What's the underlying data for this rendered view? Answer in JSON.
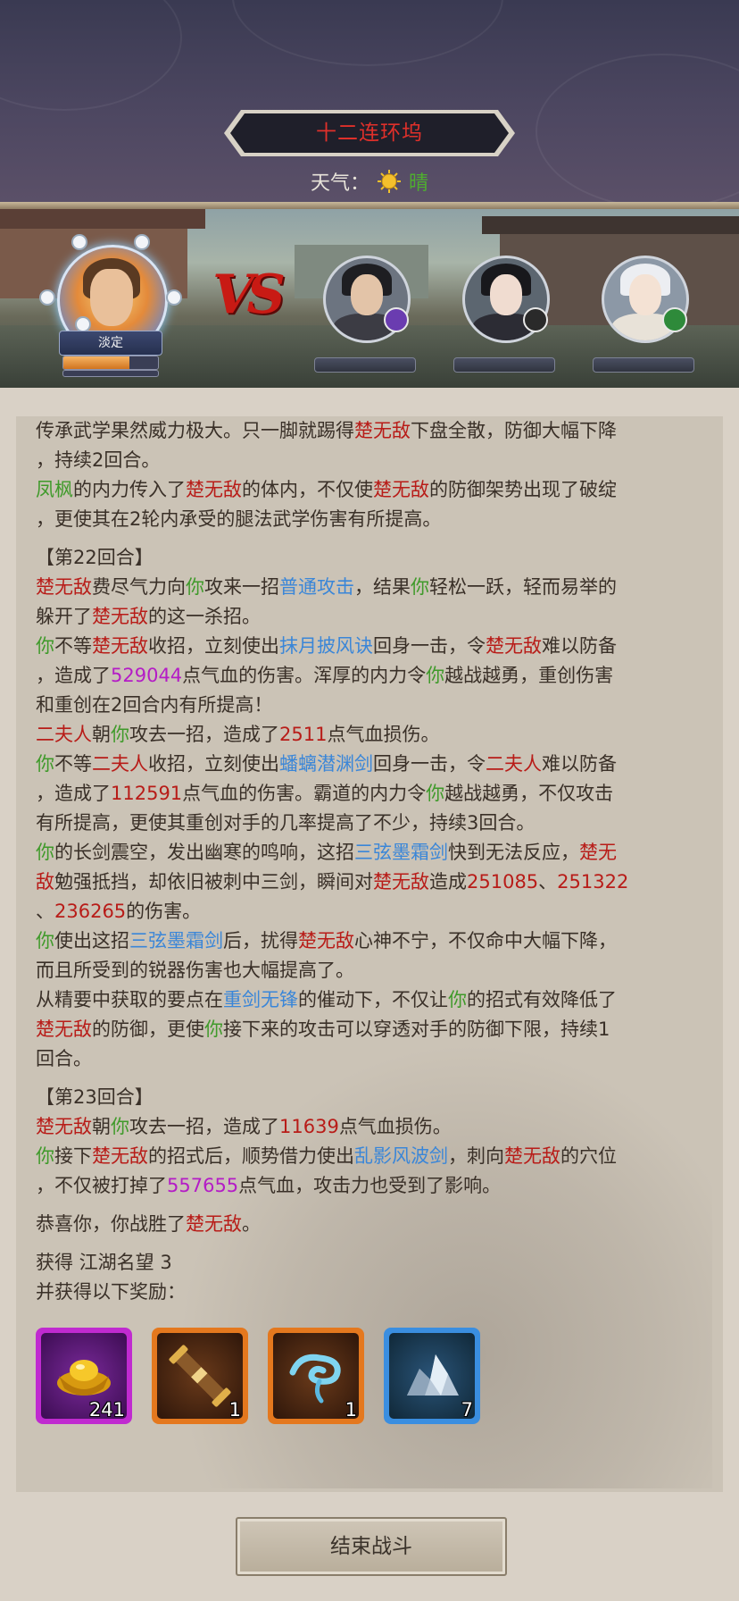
{
  "header": {
    "location_title": "十二连环坞",
    "weather_label": "天气：",
    "weather_icon": "sun-icon",
    "weather_value": "晴"
  },
  "battle": {
    "player_status": "淡定",
    "player_hp_fraction": 0.7,
    "vs_text": "VS",
    "enemies": [
      {
        "icon": "enemy-1-avatar",
        "badge_color": "#6a3cb0"
      },
      {
        "icon": "enemy-2-avatar",
        "badge_color": "#2a2a2a"
      },
      {
        "icon": "enemy-3-avatar",
        "badge_color": "#2e8a3a"
      }
    ]
  },
  "colors": {
    "enemy_name": "#b81c18",
    "ally_name": "#3f9a2a",
    "skill": "#3a86d8",
    "damage": "#b41cc6"
  },
  "log": {
    "l1": {
      "a": "传承武学果然威力极大。只一脚就踢得",
      "b": "楚无敌",
      "c": "下盘全散，防御大幅下降"
    },
    "l2": "，持续2回合。",
    "l3": {
      "a": "凤枫",
      "b": "的内力传入了",
      "c": "楚无敌",
      "d": "的体内，不仅使",
      "e": "楚无敌",
      "f": "的防御架势出现了破绽"
    },
    "l4": "，更使其在2轮内承受的腿法武学伤害有所提高。",
    "round22": "【第22回合】",
    "l5": {
      "a": "楚无敌",
      "b": "费尽气力向",
      "c": "你",
      "d": "攻来一招",
      "e": "普通攻击",
      "f": "，结果",
      "g": "你",
      "h": "轻松一跃，轻而易举的"
    },
    "l6": {
      "a": "躲开了",
      "b": "楚无敌",
      "c": "的这一杀招。"
    },
    "l7": {
      "a": "你",
      "b": "不等",
      "c": "楚无敌",
      "d": "收招，立刻使出",
      "e": "抹月披风诀",
      "f": "回身一击，令",
      "g": "楚无敌",
      "h": "难以防备"
    },
    "l8": {
      "a": "，造成了",
      "b": "529044",
      "c": "点气血的伤害。浑厚的内力令",
      "d": "你",
      "e": "越战越勇，重创伤害"
    },
    "l9": "和重创在2回合内有所提高！",
    "l10": {
      "a": "二夫人",
      "b": "朝",
      "c": "你",
      "d": "攻去一招，造成了",
      "e": "2511",
      "f": "点气血损伤。"
    },
    "l11": {
      "a": "你",
      "b": "不等",
      "c": "二夫人",
      "d": "收招，立刻使出",
      "e": "蟠螭潜渊剑",
      "f": "回身一击，令",
      "g": "二夫人",
      "h": "难以防备"
    },
    "l12": {
      "a": "，造成了",
      "b": "112591",
      "c": "点气血的伤害。霸道的内力令",
      "d": "你",
      "e": "越战越勇，不仅攻击"
    },
    "l13": "有所提高，更使其重创对手的几率提高了不少，持续3回合。",
    "l14": {
      "a": "你",
      "b": "的长剑震空，发出幽寒的鸣响，这招",
      "c": "三弦墨霜剑",
      "d": "快到无法反应，",
      "e": "楚无"
    },
    "l15": {
      "a": "敌",
      "b": "勉强抵挡，却依旧被刺中三剑，瞬间对",
      "c": "楚无敌",
      "d": "造成",
      "e": "251085",
      "f": "、",
      "g": "251322"
    },
    "l16": {
      "a": "、",
      "b": "236265",
      "c": "的伤害。"
    },
    "l17": {
      "a": "你",
      "b": "使出这招",
      "c": "三弦墨霜剑",
      "d": "后，扰得",
      "e": "楚无敌",
      "f": "心神不宁，不仅命中大幅下降，"
    },
    "l18": "而且所受到的锐器伤害也大幅提高了。",
    "l19": {
      "a": "从精要中获取的要点在",
      "b": "重剑无锋",
      "c": "的催动下，不仅让",
      "d": "你",
      "e": "的招式有效降低了"
    },
    "l20": {
      "a": "楚无敌",
      "b": "的防御，更使",
      "c": "你",
      "d": "接下来的攻击可以穿透对手的防御下限，持续1"
    },
    "l21": "回合。",
    "round23": "【第23回合】",
    "l22": {
      "a": "楚无敌",
      "b": "朝",
      "c": "你",
      "d": "攻去一招，造成了",
      "e": "11639",
      "f": "点气血损伤。"
    },
    "l23": {
      "a": "你",
      "b": "接下",
      "c": "楚无敌",
      "d": "的招式后，顺势借力使出",
      "e": "乱影风波剑",
      "f": "，刺向",
      "g": "楚无敌",
      "h": "的穴位"
    },
    "l24": {
      "a": "，不仅被打掉了",
      "b": "557655",
      "c": "点气血，攻击力也受到了影响。"
    },
    "victory": {
      "a": "恭喜你，你战胜了",
      "b": "楚无敌",
      "c": "。"
    },
    "reputation": "获得 江湖名望 3",
    "rewards_intro": "并获得以下奖励："
  },
  "rewards": [
    {
      "icon": "gold-ingot-icon",
      "count": "241",
      "frame_color": "#c02ad0"
    },
    {
      "icon": "scroll-icon",
      "count": "1",
      "frame_color": "#e4781e"
    },
    {
      "icon": "cloud-swirl-icon",
      "count": "1",
      "frame_color": "#e4781e"
    },
    {
      "icon": "crystal-ore-icon",
      "count": "7",
      "frame_color": "#3a8ee0"
    }
  ],
  "end_button": "结束战斗"
}
